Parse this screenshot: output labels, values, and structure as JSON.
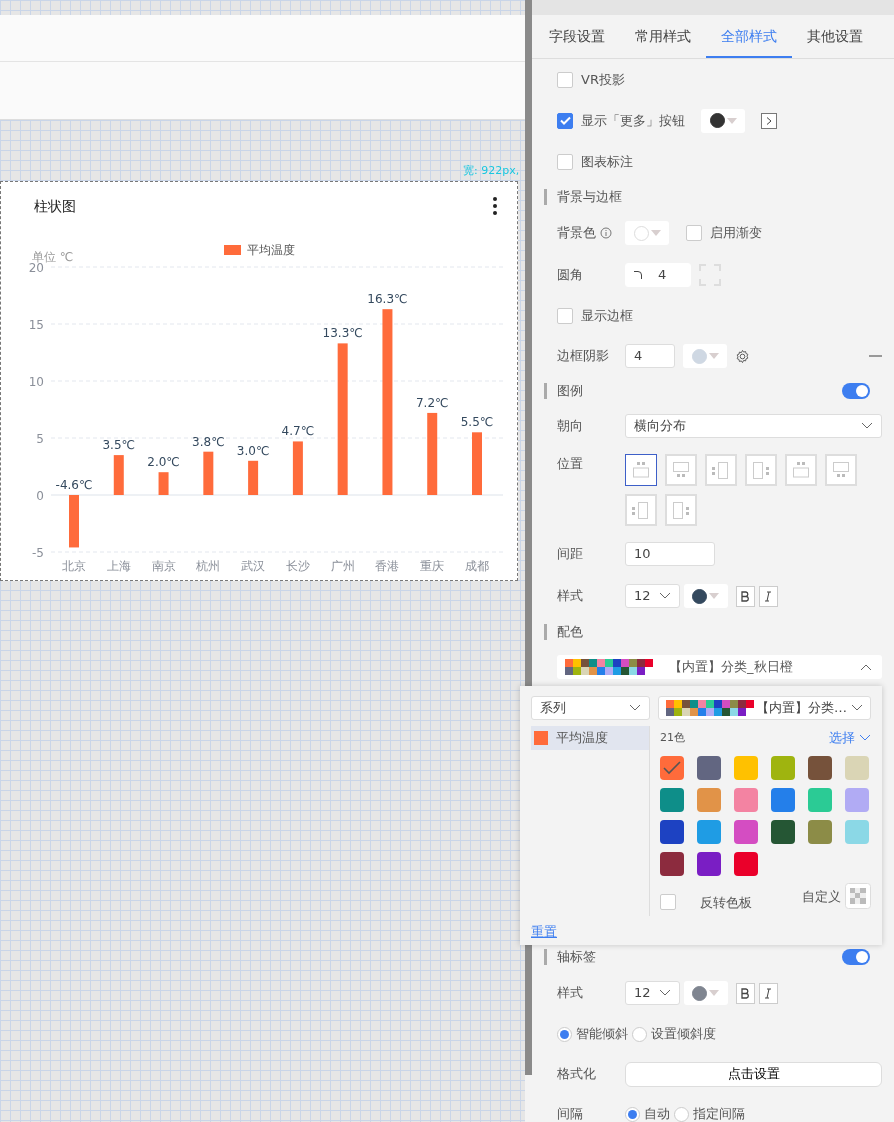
{
  "canvas": {
    "size_label": "宽: 922px,",
    "chart_card": {
      "title": "柱状图",
      "unit": "单位 ℃",
      "chart_data": {
        "type": "bar",
        "categories": [
          "北京",
          "上海",
          "南京",
          "杭州",
          "武汉",
          "长沙",
          "广州",
          "香港",
          "重庆",
          "成都"
        ],
        "series": [
          {
            "name": "平均温度",
            "color": "#ff6b3b",
            "values": [
              -4.6,
              3.5,
              2.0,
              3.8,
              3.0,
              4.7,
              13.3,
              16.3,
              7.2,
              5.5
            ]
          }
        ],
        "ylim": [
          -5,
          20
        ],
        "grid": true,
        "yticks": [
          -5,
          0,
          5,
          10,
          15,
          20
        ],
        "value_labels": [
          "-4.6℃",
          "3.5℃",
          "2.0℃",
          "3.8℃",
          "3.0℃",
          "4.7℃",
          "13.3℃",
          "16.3℃",
          "7.2℃",
          "5.5℃"
        ]
      }
    }
  },
  "panel": {
    "tabs": [
      {
        "label": "字段设置",
        "selected": false
      },
      {
        "label": "常用样式",
        "selected": false
      },
      {
        "label": "全部样式",
        "selected": true
      },
      {
        "label": "其他设置",
        "selected": false
      }
    ],
    "rows": [
      {
        "kind": "checkbox",
        "label": "VR投影",
        "checked": false
      },
      {
        "kind": "checkbox",
        "label": "显示「更多」按钮",
        "checked": true,
        "color": "#333333",
        "arrow_button": true
      },
      {
        "kind": "checkbox",
        "label": "图表标注",
        "checked": false
      },
      {
        "kind": "section",
        "label": "背景与边框"
      },
      {
        "kind": "background",
        "label": "背景色",
        "color": "#ffffff",
        "gradient_label": "启用渐变",
        "gradient": false
      },
      {
        "kind": "corner",
        "label": "圆角",
        "value": "4"
      },
      {
        "kind": "checkbox",
        "label": "显示边框",
        "checked": false
      },
      {
        "kind": "shadow",
        "label": "边框阴影",
        "value": "4",
        "color": "#cfd8e3"
      },
      {
        "kind": "section",
        "label": "图例",
        "on": true
      },
      {
        "kind": "select",
        "label": "朝向",
        "value": "横向分布"
      },
      {
        "kind": "position",
        "label": "位置",
        "options": [
          {
            "selected": true
          },
          {
            "selected": false
          },
          {
            "selected": false
          },
          {
            "selected": false
          },
          {
            "selected": false
          },
          {
            "selected": false
          },
          {
            "selected": false
          },
          {
            "selected": false
          }
        ]
      },
      {
        "kind": "number",
        "label": "间距",
        "value": "10"
      },
      {
        "kind": "font",
        "label": "样式",
        "size": "12",
        "color": "#34495e"
      },
      {
        "kind": "section",
        "label": "配色"
      },
      {
        "kind": "palette",
        "value": "【内置】分类_秋日橙",
        "expanded": true
      },
      {
        "kind": "section",
        "label": "轴标签",
        "on": true
      },
      {
        "kind": "font",
        "label": "样式",
        "size": "12",
        "color": "#7f8590"
      },
      {
        "kind": "radios",
        "options": [
          {
            "label": "智能倾斜",
            "selected": true
          },
          {
            "label": "设置倾斜度",
            "selected": false
          }
        ]
      },
      {
        "kind": "button",
        "label": "格式化",
        "button": "点击设置"
      },
      {
        "kind": "radios",
        "label": "间隔",
        "options": [
          {
            "label": "自动",
            "selected": true
          },
          {
            "label": "指定间隔",
            "selected": false
          }
        ]
      }
    ],
    "popup": {
      "series_select": "系列",
      "scheme_select": "【内置】分类…",
      "series": [
        {
          "label": "平均温度",
          "color": "#ff6b3b",
          "selected": true
        }
      ],
      "count": "21色",
      "choose": "选择",
      "colors": [
        {
          "color": "#ff6b3b",
          "selected": true
        },
        {
          "color": "#626681",
          "selected": false
        },
        {
          "color": "#ffc100",
          "selected": false
        },
        {
          "color": "#9fb40f",
          "selected": false
        },
        {
          "color": "#76523b",
          "selected": false
        },
        {
          "color": "#dad5b5",
          "selected": false
        },
        {
          "color": "#0e8e89",
          "selected": false
        },
        {
          "color": "#e19348",
          "selected": false
        },
        {
          "color": "#f383a2",
          "selected": false
        },
        {
          "color": "#247fea",
          "selected": false
        },
        {
          "color": "#2bcb95",
          "selected": false
        },
        {
          "color": "#b1abf4",
          "selected": false
        },
        {
          "color": "#1d42c2",
          "selected": false
        },
        {
          "color": "#1f9ce4",
          "selected": false
        },
        {
          "color": "#d44dc2",
          "selected": false
        },
        {
          "color": "#255634",
          "selected": false
        },
        {
          "color": "#8c8c47",
          "selected": false
        },
        {
          "color": "#8bd8e6",
          "selected": false
        },
        {
          "color": "#8c2b3e",
          "selected": false
        },
        {
          "color": "#7a1ec4",
          "selected": false
        },
        {
          "color": "#ea002a",
          "selected": false
        }
      ],
      "invert_label": "反转色板",
      "invert": false,
      "custom": "自定义",
      "reset": "重置"
    }
  }
}
